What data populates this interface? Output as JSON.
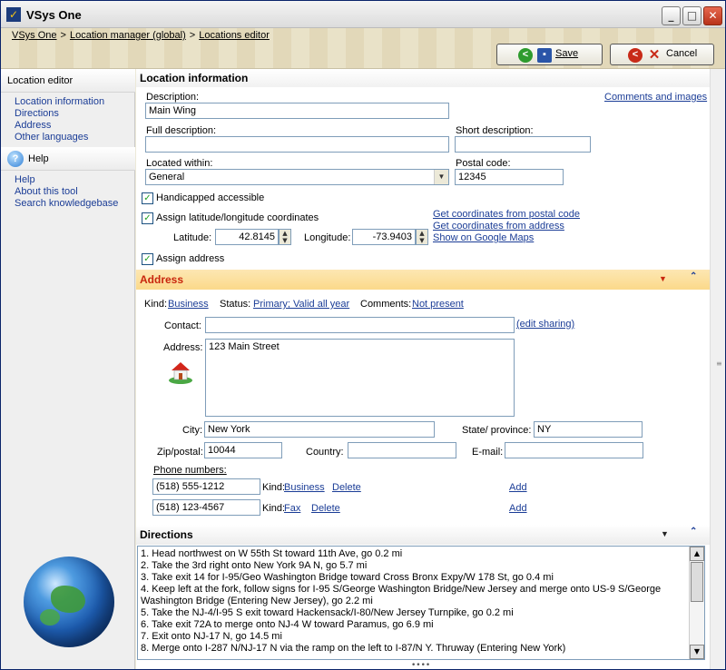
{
  "window": {
    "title": "VSys One",
    "app_icon": "vsys-logo-icon",
    "minimize_icon": "minimize-icon",
    "maximize_icon": "maximize-icon",
    "close_icon": "close-icon"
  },
  "breadcrumb": [
    "VSys One",
    "Location manager (global)",
    "Locations editor"
  ],
  "toolbar": {
    "save_label": "Save",
    "cancel_label": "Cancel"
  },
  "sidebar": {
    "editor_header": "Location editor",
    "editor_links": [
      "Location information",
      "Directions",
      "Address",
      "Other languages"
    ],
    "help_header": "Help",
    "help_links": [
      "Help",
      "About this tool",
      "Search knowledgebase"
    ]
  },
  "location_info": {
    "header": "Location information",
    "comments_link": "Comments and images",
    "description_label": "Description:",
    "description_value": "Main Wing",
    "full_description_label": "Full description:",
    "full_description_value": "",
    "short_description_label": "Short description:",
    "short_description_value": "",
    "located_within_label": "Located within:",
    "located_within_value": "General",
    "postal_code_label": "Postal code:",
    "postal_code_value": "12345",
    "handicapped_label": "Handicapped accessible",
    "assign_latlong_label": "Assign latitude/longitude coordinates",
    "latitude_label": "Latitude:",
    "latitude_value": "42.8145",
    "longitude_label": "Longitude:",
    "longitude_value": "-73.9403",
    "coords_from_postal": "Get coordinates from postal code",
    "coords_from_address": "Get coordinates from address",
    "show_map": "Show on Google Maps",
    "assign_address_label": "Assign address"
  },
  "address": {
    "header": "Address",
    "kind_label": "Kind:",
    "kind_value": "Business",
    "status_label": "Status:",
    "status_value": "Primary; Valid all year",
    "comments_label": "Comments:",
    "comments_value": "Not present",
    "contact_label": "Contact:",
    "contact_value": "",
    "edit_sharing": "(edit sharing)",
    "address_label": "Address:",
    "address_value": "123 Main Street",
    "city_label": "City:",
    "city_value": "New York",
    "state_label": "State/ province:",
    "state_value": "NY",
    "zip_label": "Zip/postal:",
    "zip_value": "10044",
    "country_label": "Country:",
    "country_value": "",
    "email_label": "E-mail:",
    "email_value": "",
    "phone_header": "Phone numbers:",
    "phones": [
      {
        "number": "(518) 555-1212",
        "kind_label": "Kind:",
        "kind": "Business",
        "delete": "Delete",
        "add": "Add"
      },
      {
        "number": "(518) 123-4567",
        "kind_label": "Kind:",
        "kind": "Fax",
        "delete": "Delete",
        "add": "Add"
      }
    ]
  },
  "directions": {
    "header": "Directions",
    "lines": [
      "1. Head northwest on W 55th St toward 11th Ave, go 0.2 mi",
      "2. Take the 3rd right onto New York 9A N, go 5.7 mi",
      "3. Take exit 14 for I-95/Geo Washington Bridge toward Cross Bronx Expy/W 178 St, go 0.4 mi",
      "4. Keep left at the fork, follow signs for I-95 S/George Washington Bridge/New Jersey and merge onto US-9 S/George Washington Bridge (Entering New Jersey), go 2.2 mi",
      "5. Take the NJ-4/I-95 S exit toward Hackensack/I-80/New Jersey Turnpike, go 0.2 mi",
      "6. Take exit 72A to merge onto NJ-4 W toward Paramus, go 6.9 mi",
      "7. Exit onto NJ-17 N, go 14.5 mi",
      "8. Merge onto I-287 N/NJ-17 N via the ramp on the left to I-87/N Y. Thruway (Entering New York)"
    ]
  },
  "colors": {
    "link": "#1a3c96",
    "address_header_bg": "#fbd98a",
    "address_header_text": "#c8260d",
    "save_icon": "#2e9b2e",
    "cancel_icon": "#c82a18"
  }
}
